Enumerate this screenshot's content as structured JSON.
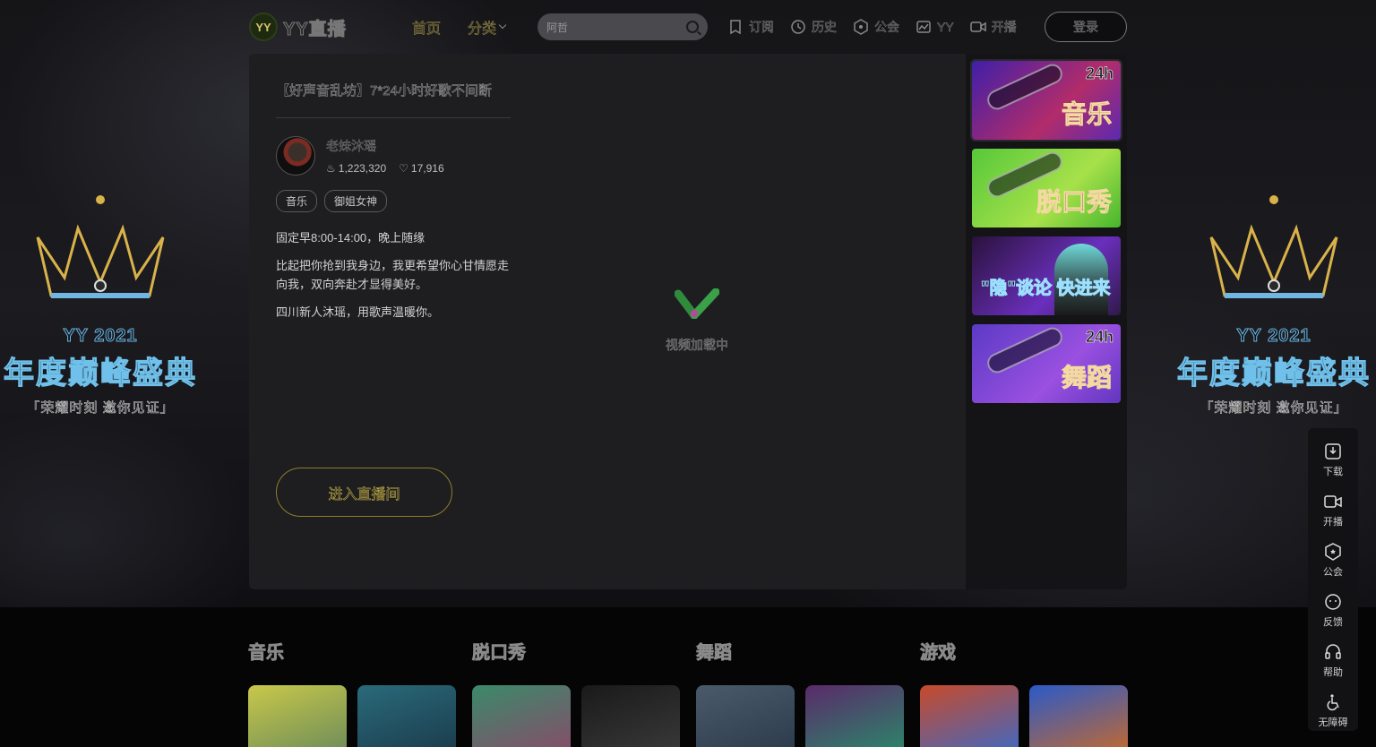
{
  "brand": {
    "logo_badge": "YY",
    "name": "YY直播"
  },
  "nav": {
    "home": "首页",
    "category": "分类",
    "search_placeholder": "阿哲",
    "items": [
      "订阅",
      "历史",
      "公会",
      "YY",
      "开播"
    ],
    "login": "登录"
  },
  "side_art": {
    "subtitle": "YY 2021",
    "title": "年度巅峰盛典",
    "slogan": "「荣耀时刻 邀你见证」"
  },
  "room": {
    "title": "【好声音乱坊】7*24小时好歌不间断",
    "anchor_name": "老妹沐瑶",
    "viewers": "1,223,320",
    "likes": "17,916",
    "tags": [
      "音乐",
      "御姐女神"
    ],
    "descriptions": [
      "固定早8:00-14:00，晚上随缘",
      "比起把你抢到我身边，我更希望你心甘情愿走向我，双向奔赴才显得美好。",
      "四川新人沐瑶，用歌声温暖你。"
    ],
    "enter_button": "进入直播间",
    "video_status": "视频加载中"
  },
  "recommend": [
    {
      "label": "音乐",
      "badge": "24h"
    },
    {
      "label": "脱口秀",
      "badge": ""
    },
    {
      "label": "\"隐\"谈论 快进来",
      "badge": ""
    },
    {
      "label": "舞蹈",
      "badge": "24h"
    }
  ],
  "toolbar": [
    "下载",
    "开播",
    "公会",
    "反馈",
    "帮助",
    "无障碍"
  ],
  "categories": [
    {
      "title": "音乐",
      "thumb_colors": [
        "#c8c84a",
        "#2a6a7a"
      ]
    },
    {
      "title": "脱口秀",
      "thumb_colors": [
        "#3a8a6a",
        "#1a1a1a"
      ]
    },
    {
      "title": "舞蹈",
      "thumb_colors": [
        "#4a5a6a",
        "#5a2a6a"
      ]
    },
    {
      "title": "游戏",
      "thumb_colors": [
        "#c84a2a",
        "#2a5ac8"
      ]
    }
  ]
}
